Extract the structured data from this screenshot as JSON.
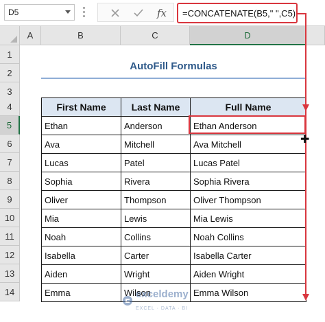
{
  "formula_bar": {
    "name_box": "D5",
    "cancel_icon": "close-icon",
    "enter_icon": "check-icon",
    "fx_label": "fx",
    "formula": "=CONCATENATE(B5,\" \",C5)"
  },
  "columns": [
    "A",
    "B",
    "C",
    "D"
  ],
  "rows": [
    "1",
    "2",
    "3",
    "4",
    "5",
    "6",
    "7",
    "8",
    "9",
    "10",
    "11",
    "12",
    "13",
    "14"
  ],
  "selected": {
    "column": "D",
    "row": "5"
  },
  "title": "AutoFill Formulas",
  "table": {
    "headers": [
      "First Name",
      "Last Name",
      "Full Name"
    ],
    "rows": [
      [
        "Ethan",
        "Anderson",
        "Ethan Anderson"
      ],
      [
        "Ava",
        "Mitchell",
        "Ava Mitchell"
      ],
      [
        "Lucas",
        "Patel",
        "Lucas Patel"
      ],
      [
        "Sophia",
        "Rivera",
        "Sophia Rivera"
      ],
      [
        "Oliver",
        "Thompson",
        "Oliver Thompson"
      ],
      [
        "Mia",
        "Lewis",
        "Mia Lewis"
      ],
      [
        "Noah",
        "Collins",
        "Noah Collins"
      ],
      [
        "Isabella",
        "Carter",
        "Isabella Carter"
      ],
      [
        "Aiden",
        "Wright",
        "Aiden Wright"
      ],
      [
        "Emma",
        "Wilson",
        "Emma Wilson"
      ]
    ]
  },
  "watermark": {
    "name": "exceldemy",
    "tagline": "EXCEL · DATA · BI"
  },
  "colors": {
    "accent_red": "#d9363e",
    "header_fill": "#dce6f2",
    "title_blue": "#2f5a8a",
    "excel_green": "#217346"
  }
}
